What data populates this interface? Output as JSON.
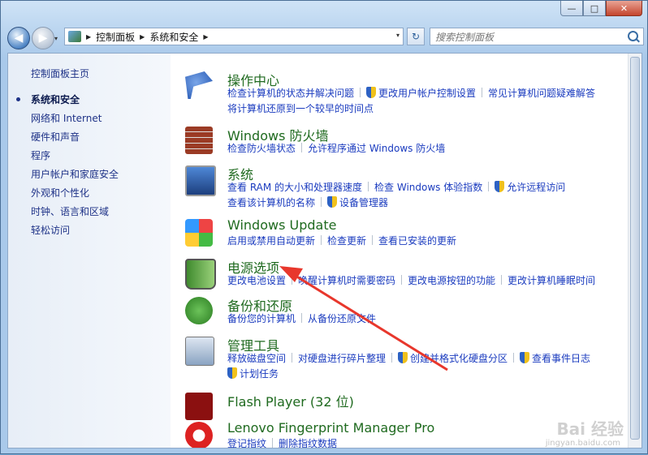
{
  "window": {
    "minimize_glyph": "—",
    "maximize_glyph": "□",
    "close_glyph": "✕"
  },
  "nav": {
    "back_glyph": "◀",
    "forward_glyph": "▶",
    "history_glyph": "▾",
    "breadcrumbs": [
      "控制面板",
      "系统和安全"
    ],
    "crumb_sep_glyph": "▶",
    "refresh_glyph": "↻",
    "search_placeholder": "搜索控制面板"
  },
  "sidebar": {
    "home": "控制面板主页",
    "items": [
      "系统和安全",
      "网络和 Internet",
      "硬件和声音",
      "程序",
      "用户帐户和家庭安全",
      "外观和个性化",
      "时钟、语言和区域",
      "轻松访问"
    ]
  },
  "categories": [
    {
      "title": "操作中心",
      "icon": "flag-icon",
      "rows": [
        [
          {
            "t": "检查计算机的状态并解决问题"
          },
          {
            "t": "更改用户帐户控制设置",
            "shield": true
          },
          {
            "t": "常见计算机问题疑难解答"
          }
        ],
        [
          {
            "t": "将计算机还原到一个较早的时间点"
          }
        ]
      ]
    },
    {
      "title": "Windows 防火墙",
      "icon": "firewall-icon",
      "rows": [
        [
          {
            "t": "检查防火墙状态"
          },
          {
            "t": "允许程序通过 Windows 防火墙"
          }
        ]
      ]
    },
    {
      "title": "系统",
      "icon": "computer-icon",
      "rows": [
        [
          {
            "t": "查看 RAM 的大小和处理器速度"
          },
          {
            "t": "检查 Windows 体验指数"
          },
          {
            "t": "允许远程访问",
            "shield": true
          }
        ],
        [
          {
            "t": "查看该计算机的名称"
          },
          {
            "t": "设备管理器",
            "shield": true
          }
        ]
      ]
    },
    {
      "title": "Windows Update",
      "icon": "windows-update-icon",
      "rows": [
        [
          {
            "t": "启用或禁用自动更新"
          },
          {
            "t": "检查更新"
          },
          {
            "t": "查看已安装的更新"
          }
        ]
      ]
    },
    {
      "title": "电源选项",
      "icon": "battery-icon",
      "rows": [
        [
          {
            "t": "更改电池设置"
          },
          {
            "t": "唤醒计算机时需要密码"
          },
          {
            "t": "更改电源按钮的功能"
          },
          {
            "t": "更改计算机睡眠时间"
          }
        ]
      ]
    },
    {
      "title": "备份和还原",
      "icon": "backup-icon",
      "rows": [
        [
          {
            "t": "备份您的计算机"
          },
          {
            "t": "从备份还原文件"
          }
        ]
      ]
    },
    {
      "title": "管理工具",
      "icon": "admin-tools-icon",
      "rows": [
        [
          {
            "t": "释放磁盘空间"
          },
          {
            "t": "对硬盘进行碎片整理"
          },
          {
            "t": "创建并格式化硬盘分区",
            "shield": true
          },
          {
            "t": "查看事件日志",
            "shield": true
          }
        ],
        [
          {
            "t": "计划任务",
            "shield": true
          }
        ]
      ]
    },
    {
      "title": "Flash Player (32 位)",
      "icon": "flash-icon",
      "rows": []
    },
    {
      "title": "Lenovo Fingerprint Manager Pro",
      "icon": "fingerprint-icon",
      "rows": [
        [
          {
            "t": "登记指纹"
          },
          {
            "t": "删除指纹数据"
          }
        ]
      ]
    }
  ],
  "watermark": {
    "main": "Bai 经验",
    "sub": "jingyan.baidu.com"
  },
  "colors": {
    "link": "#1a3bbf",
    "title": "#1f6a1f",
    "arrow": "#e8372c"
  }
}
